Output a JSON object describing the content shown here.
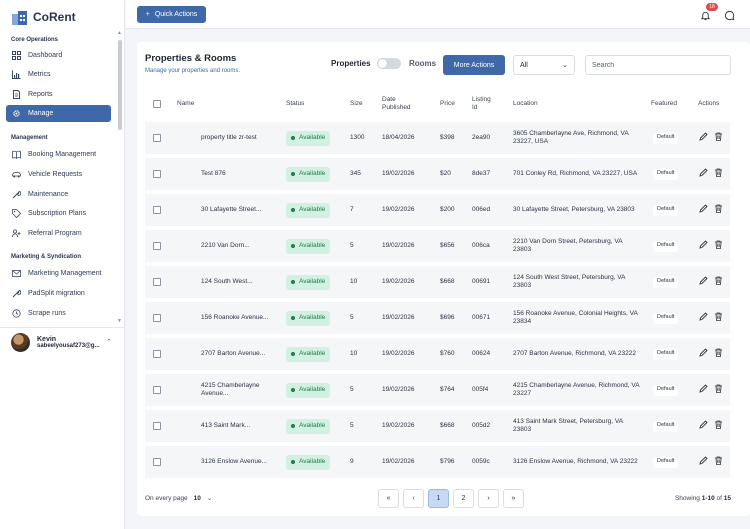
{
  "brand": {
    "name": "CoRent"
  },
  "sidebar": {
    "sections": [
      {
        "label": "Core Operations",
        "items": [
          {
            "label": "Dashboard",
            "icon": "grid-icon"
          },
          {
            "label": "Metrics",
            "icon": "chart-icon"
          },
          {
            "label": "Reports",
            "icon": "document-icon"
          },
          {
            "label": "Manage",
            "icon": "gear-icon",
            "active": true
          }
        ]
      },
      {
        "label": "Management",
        "items": [
          {
            "label": "Booking Management",
            "icon": "book-icon"
          },
          {
            "label": "Vehicle Requests",
            "icon": "car-icon"
          },
          {
            "label": "Maintenance",
            "icon": "wrench-icon"
          },
          {
            "label": "Subscription Plans",
            "icon": "tag-icon"
          },
          {
            "label": "Referral Program",
            "icon": "user-plus-icon"
          }
        ]
      },
      {
        "label": "Marketing & Syndication",
        "items": [
          {
            "label": "Marketing Management",
            "icon": "mail-icon"
          },
          {
            "label": "PadSplit migration",
            "icon": "wrench-icon"
          },
          {
            "label": "Scrape runs",
            "icon": "history-icon"
          }
        ]
      }
    ],
    "user": {
      "name": "Kevin",
      "email": "sabeelyousaf273@g..."
    }
  },
  "topbar": {
    "quick_actions": "Quick Actions",
    "notifications_count": "18"
  },
  "page": {
    "title": "Properties & Rooms",
    "subtitle": "Manage your properties and rooms.",
    "toggle_left": "Properties",
    "toggle_right": "Rooms",
    "more_actions": "More Actions",
    "filter_value": "All",
    "search_placeholder": "Search"
  },
  "table": {
    "headers": {
      "name": "Name",
      "status": "Status",
      "size": "Size",
      "date": "Date Published",
      "price": "Price",
      "listing": "Listing Id",
      "location": "Location",
      "featured": "Featured",
      "actions": "Actions"
    },
    "rows": [
      {
        "name": "property title zr-test",
        "status": "Available",
        "size": "1300",
        "date": "18/04/2026",
        "price": "$398",
        "listing": "2ea90",
        "location": "3605 Chamberlayne Ave, Richmond, VA 23227, USA",
        "featured": "Default"
      },
      {
        "name": "Test 876",
        "status": "Available",
        "size": "345",
        "date": "19/02/2026",
        "price": "$20",
        "listing": "8de37",
        "location": "701 Conley Rd, Richmond, VA 23227, USA",
        "featured": "Default"
      },
      {
        "name": "30 Lafayette Street...",
        "status": "Available",
        "size": "7",
        "date": "19/02/2026",
        "price": "$200",
        "listing": "006ed",
        "location": "30 Lafayette Street, Petersburg, VA 23803",
        "featured": "Default"
      },
      {
        "name": "2210 Van Dorn...",
        "status": "Available",
        "size": "5",
        "date": "19/02/2026",
        "price": "$656",
        "listing": "006ca",
        "location": "2210 Van Dorn Street, Petersburg, VA 23803",
        "featured": "Default"
      },
      {
        "name": "124 South West...",
        "status": "Available",
        "size": "10",
        "date": "19/02/2026",
        "price": "$668",
        "listing": "00691",
        "location": "124 South West Street, Petersburg, VA 23803",
        "featured": "Default"
      },
      {
        "name": "156 Roanoke Avenue...",
        "status": "Available",
        "size": "5",
        "date": "19/02/2026",
        "price": "$696",
        "listing": "00671",
        "location": "156 Roanoke Avenue, Colonial Heights, VA 23834",
        "featured": "Default"
      },
      {
        "name": "2707 Barton Avenue...",
        "status": "Available",
        "size": "10",
        "date": "19/02/2026",
        "price": "$760",
        "listing": "00624",
        "location": "2707 Barton Avenue, Richmond, VA 23222",
        "featured": "Default"
      },
      {
        "name": "4215 Chamberlayne Avenue...",
        "status": "Available",
        "size": "5",
        "date": "19/02/2026",
        "price": "$764",
        "listing": "005f4",
        "location": "4215 Chamberlayne Avenue, Richmond, VA 23227",
        "featured": "Default"
      },
      {
        "name": "413 Saint Mark...",
        "status": "Available",
        "size": "5",
        "date": "19/02/2026",
        "price": "$668",
        "listing": "005d2",
        "location": "413 Saint Mark Street, Petersburg, VA 23803",
        "featured": "Default"
      },
      {
        "name": "3126 Enslow Avenue...",
        "status": "Available",
        "size": "9",
        "date": "19/02/2026",
        "price": "$796",
        "listing": "0059c",
        "location": "3126 Enslow Avenue, Richmond, VA 23222",
        "featured": "Default"
      }
    ]
  },
  "pagination": {
    "per_page_label": "On every page",
    "per_page_value": "10",
    "pages": [
      "1",
      "2"
    ],
    "current": "1",
    "showing_prefix": "Showing",
    "showing_range": "1-10",
    "showing_of": "of",
    "showing_total": "15"
  },
  "colors": {
    "accent": "#3f68a8",
    "available_bg": "#d2f1e2",
    "available_text": "#1f7a4e",
    "badge": "#e24b4b"
  }
}
